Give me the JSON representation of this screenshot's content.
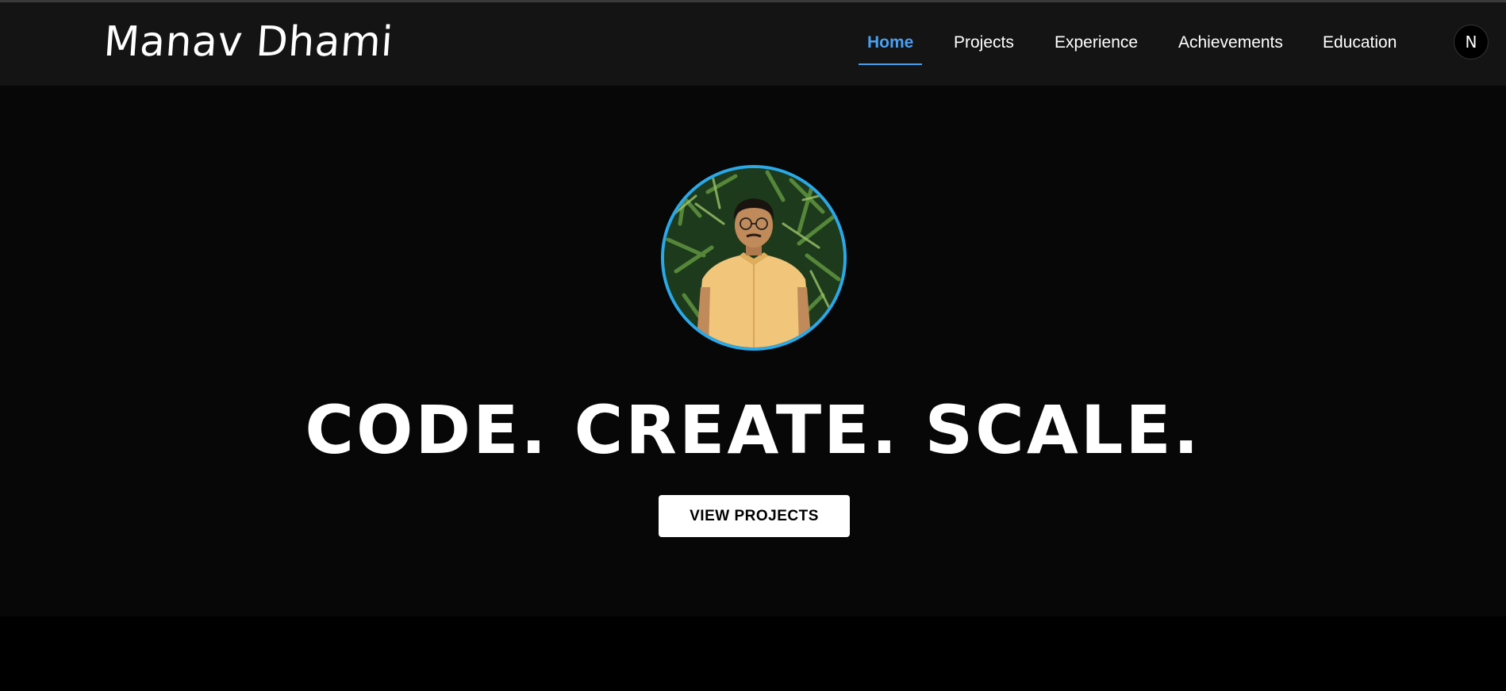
{
  "brand": {
    "name": "Manav Dhami"
  },
  "nav": {
    "items": [
      {
        "label": "Home",
        "active": true
      },
      {
        "label": "Projects",
        "active": false
      },
      {
        "label": "Experience",
        "active": false
      },
      {
        "label": "Achievements",
        "active": false
      },
      {
        "label": "Education",
        "active": false
      }
    ],
    "badge_letter": "N"
  },
  "hero": {
    "headline": "CODE. CREATE. SCALE.",
    "cta_label": "VIEW PROJECTS"
  },
  "colors": {
    "accent": "#4a9ff0",
    "avatar_ring": "#2aa8e8",
    "navbar_bg": "#141414",
    "hero_bg": "#070707"
  }
}
